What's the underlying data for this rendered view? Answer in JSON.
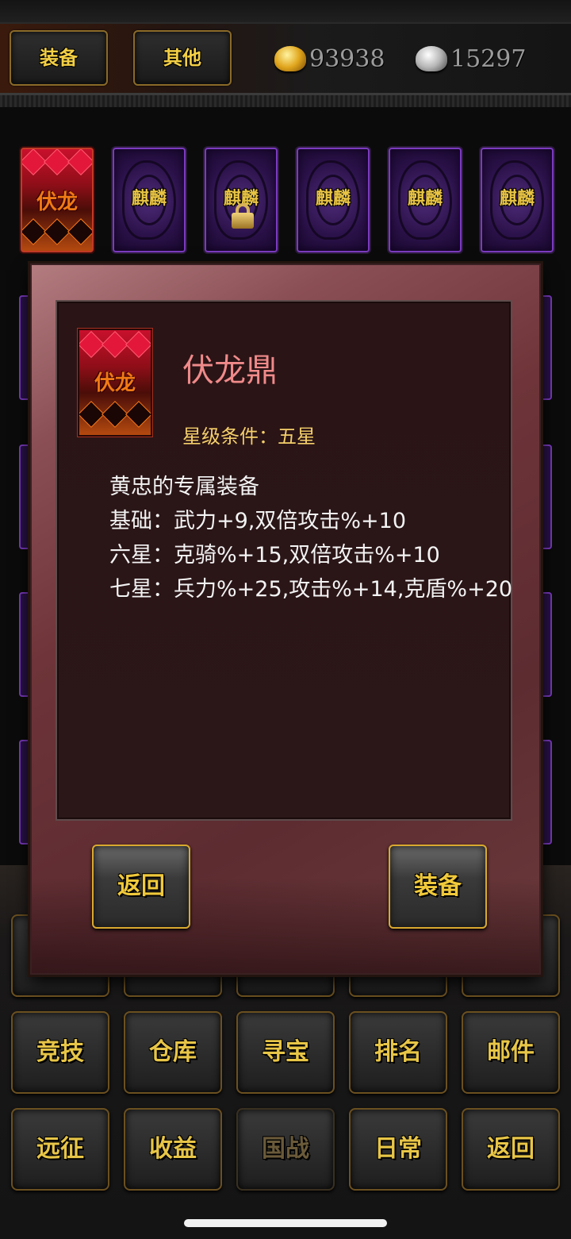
{
  "top_bar": {
    "tab_equipment": "装备",
    "tab_other": "其他",
    "gold_amount": "93938",
    "silver_amount": "15297"
  },
  "cards": [
    {
      "label": "伏龙",
      "selected": true,
      "locked": false
    },
    {
      "label": "麒麟",
      "selected": false,
      "locked": false
    },
    {
      "label": "麒麟",
      "selected": false,
      "locked": true
    },
    {
      "label": "麒麟",
      "selected": false,
      "locked": false
    },
    {
      "label": "麒麟",
      "selected": false,
      "locked": false
    },
    {
      "label": "麒麟",
      "selected": false,
      "locked": false
    }
  ],
  "modal": {
    "icon_label": "伏龙",
    "item_name": "伏龙鼎",
    "star_requirement": "星级条件：五星",
    "description_lines": [
      "黄忠的专属装备",
      "基础：武力+9,双倍攻击%+10",
      "六星：克骑%+15,双倍攻击%+10",
      "七星：兵力%+25,攻击%+14,克盾%+20"
    ],
    "back_label": "返回",
    "equip_label": "装备"
  },
  "menu": {
    "row1": [
      "竞技",
      "仓库",
      "寻宝",
      "排名",
      "邮件"
    ],
    "row2": [
      "远征",
      "收益",
      "国战",
      "日常",
      "返回"
    ],
    "disabled_item": "国战"
  },
  "colors": {
    "accent_gold": "#f3cf45",
    "item_name": "#f08a8a",
    "star_text": "#f4cf6a",
    "card_purple": "#7b3bbf",
    "card_red": "#c8102c"
  }
}
